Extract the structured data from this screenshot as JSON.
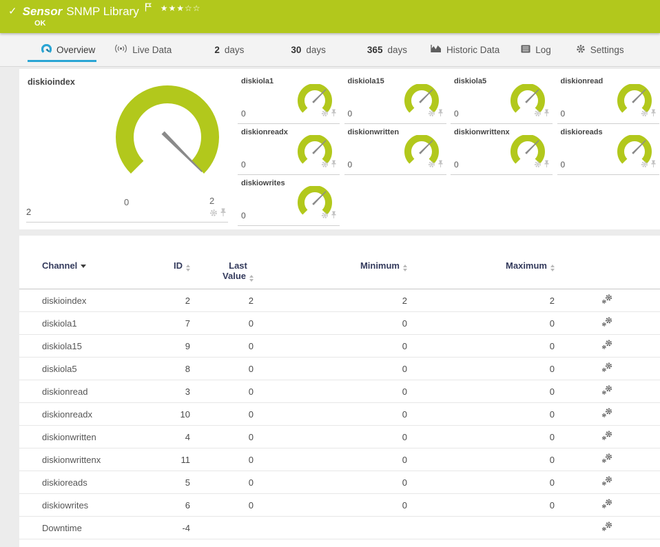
{
  "header": {
    "check_icon": "✓",
    "type_label": "Sensor",
    "title": "SNMP Library",
    "status": "OK",
    "stars_filled": "★★★",
    "stars_empty": "☆☆",
    "band_color": "#b2c81c"
  },
  "tabs": {
    "overview": "Overview",
    "live_data": "Live Data",
    "d2_num": "2",
    "d2_label": "days",
    "d30_num": "30",
    "d30_label": "days",
    "d365_num": "365",
    "d365_label": "days",
    "historic": "Historic Data",
    "log": "Log",
    "settings": "Settings"
  },
  "gauges": {
    "accent_color": "#b2c81c",
    "needle_color": "#8a8a8a",
    "main": {
      "name": "diskioindex",
      "value": "2",
      "scale_min": "0",
      "scale_max": "2"
    },
    "small": [
      {
        "name": "diskiola1",
        "value": "0"
      },
      {
        "name": "diskiola15",
        "value": "0"
      },
      {
        "name": "diskiola5",
        "value": "0"
      },
      {
        "name": "diskionread",
        "value": "0"
      },
      {
        "name": "diskionreadx",
        "value": "0"
      },
      {
        "name": "diskionwritten",
        "value": "0"
      },
      {
        "name": "diskionwrittenx",
        "value": "0"
      },
      {
        "name": "diskioreads",
        "value": "0"
      },
      {
        "name": "diskiowrites",
        "value": "0"
      }
    ]
  },
  "table": {
    "headers": {
      "channel": "Channel",
      "id": "ID",
      "last_line1": "Last",
      "last_line2": "Value",
      "min": "Minimum",
      "max": "Maximum"
    },
    "rows": [
      {
        "channel": "diskioindex",
        "id": "2",
        "last": "2",
        "min": "2",
        "max": "2"
      },
      {
        "channel": "diskiola1",
        "id": "7",
        "last": "0",
        "min": "0",
        "max": "0"
      },
      {
        "channel": "diskiola15",
        "id": "9",
        "last": "0",
        "min": "0",
        "max": "0"
      },
      {
        "channel": "diskiola5",
        "id": "8",
        "last": "0",
        "min": "0",
        "max": "0"
      },
      {
        "channel": "diskionread",
        "id": "3",
        "last": "0",
        "min": "0",
        "max": "0"
      },
      {
        "channel": "diskionreadx",
        "id": "10",
        "last": "0",
        "min": "0",
        "max": "0"
      },
      {
        "channel": "diskionwritten",
        "id": "4",
        "last": "0",
        "min": "0",
        "max": "0"
      },
      {
        "channel": "diskionwrittenx",
        "id": "11",
        "last": "0",
        "min": "0",
        "max": "0"
      },
      {
        "channel": "diskioreads",
        "id": "5",
        "last": "0",
        "min": "0",
        "max": "0"
      },
      {
        "channel": "diskiowrites",
        "id": "6",
        "last": "0",
        "min": "0",
        "max": "0"
      },
      {
        "channel": "Downtime",
        "id": "-4",
        "last": "",
        "min": "",
        "max": ""
      }
    ]
  },
  "colors": {
    "accent_green": "#b2c81c",
    "accent_blue": "#2aa5d4",
    "table_header_text": "#333a5c"
  }
}
